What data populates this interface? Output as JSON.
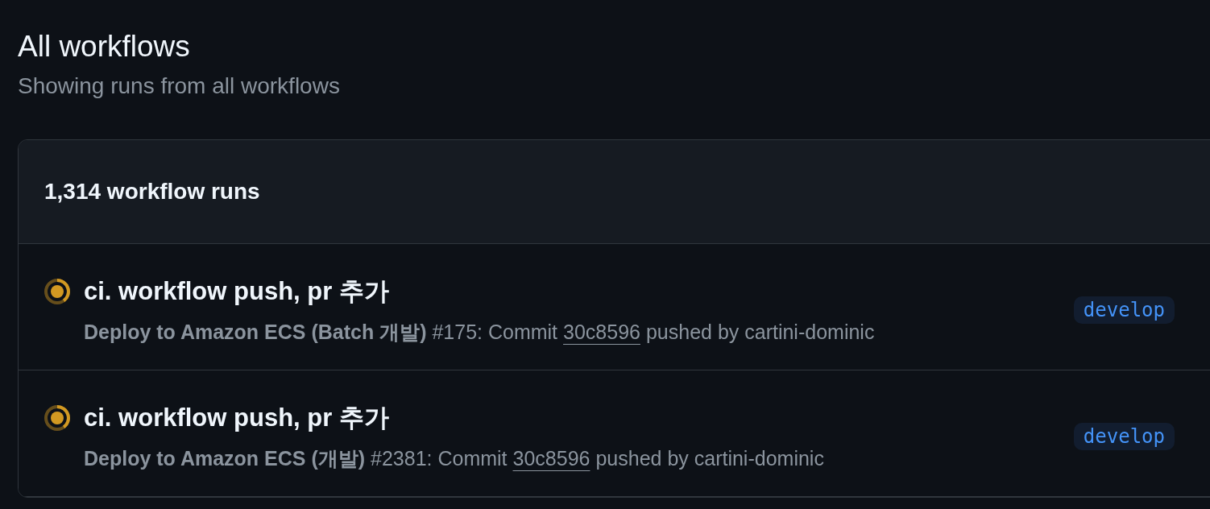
{
  "page": {
    "title": "All workflows",
    "subtitle": "Showing runs from all workflows"
  },
  "runs": {
    "count": "1,314 workflow runs",
    "items": [
      {
        "running": true,
        "title": "ci. workflow push, pr 추가",
        "workflow": "Deploy to Amazon ECS (Batch 개발)",
        "number_text": "#175: Commit",
        "commit": "30c8596",
        "actor_text": "pushed by cartini-dominic",
        "branch": "develop"
      },
      {
        "running": true,
        "title": "ci. workflow push, pr 추가",
        "workflow": "Deploy to Amazon ECS (개발)",
        "number_text": "#2381: Commit",
        "commit": "30c8596",
        "actor_text": "pushed by cartini-dominic",
        "branch": "develop"
      }
    ]
  }
}
